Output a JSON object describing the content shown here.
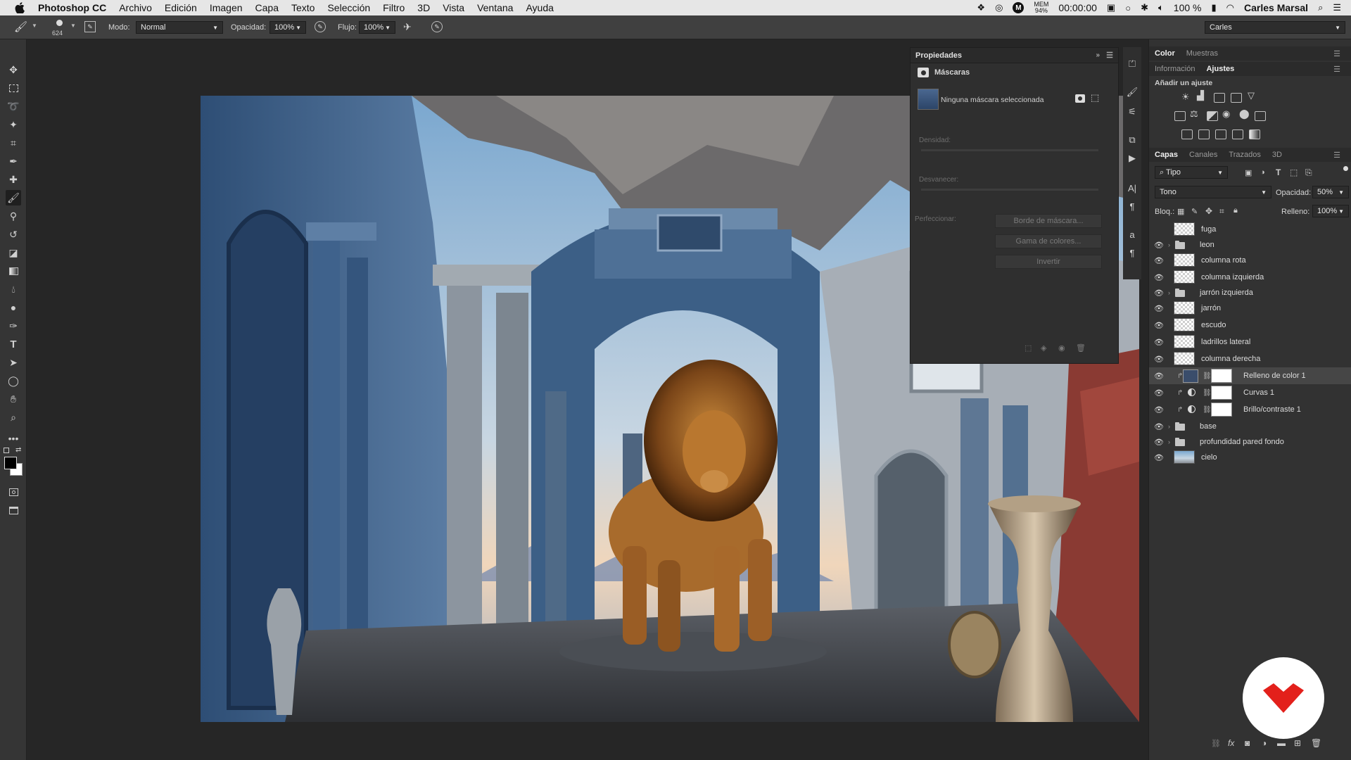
{
  "menubar": {
    "app": "Photoshop CC",
    "items": [
      "Archivo",
      "Edición",
      "Imagen",
      "Capa",
      "Texto",
      "Selección",
      "Filtro",
      "3D",
      "Vista",
      "Ventana",
      "Ayuda"
    ],
    "mem_label": "MEM",
    "mem_value": "94%",
    "timer": "00:00:00",
    "battery": "100 %",
    "user": "Carles Marsal"
  },
  "optionsbar": {
    "brush_size": "624",
    "modo_label": "Modo:",
    "modo_value": "Normal",
    "opacidad_label": "Opacidad:",
    "opacidad_value": "100%",
    "flujo_label": "Flujo:",
    "flujo_value": "100%",
    "workspace": "Carles"
  },
  "properties": {
    "title": "Propiedades",
    "section": "Máscaras",
    "mask_status": "Ninguna máscara seleccionada",
    "densidad_label": "Densidad:",
    "desvanecer_label": "Desvanecer:",
    "perfeccionar_label": "Perfeccionar:",
    "btn_borde": "Borde de máscara...",
    "btn_gama": "Gama de colores...",
    "btn_invertir": "Invertir"
  },
  "color_panel": {
    "tab1": "Color",
    "tab2": "Muestras"
  },
  "adjust_panel": {
    "tab1": "Información",
    "tab2": "Ajustes",
    "add_label": "Añadir un ajuste"
  },
  "layers_panel": {
    "tabs": [
      "Capas",
      "Canales",
      "Trazados",
      "3D"
    ],
    "filter_kind": "Tipo",
    "blend_mode": "Tono",
    "opacity_label": "Opacidad:",
    "opacity_value": "50%",
    "lock_label": "Bloq.:",
    "fill_label": "Relleno:",
    "fill_value": "100%",
    "layers": [
      {
        "name": "fuga",
        "type": "pixel",
        "visible": false
      },
      {
        "name": "leon",
        "type": "group",
        "visible": true
      },
      {
        "name": "columna rota",
        "type": "pixel",
        "visible": true
      },
      {
        "name": "columna izquierda",
        "type": "pixel",
        "visible": true
      },
      {
        "name": "jarrón izquierda",
        "type": "group",
        "visible": true
      },
      {
        "name": "jarrón",
        "type": "smart",
        "visible": true
      },
      {
        "name": "escudo",
        "type": "smart",
        "visible": true
      },
      {
        "name": "ladrillos lateral",
        "type": "pixel",
        "visible": true
      },
      {
        "name": "columna derecha",
        "type": "pixel",
        "visible": true
      },
      {
        "name": "Relleno de color 1",
        "type": "fill",
        "visible": true,
        "selected": true
      },
      {
        "name": "Curvas 1",
        "type": "adjustment",
        "visible": true
      },
      {
        "name": "Brillo/contraste 1",
        "type": "adjustment",
        "visible": true
      },
      {
        "name": "base",
        "type": "group",
        "visible": true
      },
      {
        "name": "profundidad pared fondo",
        "type": "group",
        "visible": true
      },
      {
        "name": "cielo",
        "type": "image",
        "visible": true
      }
    ]
  },
  "colors": {
    "fill_swatch": "#3a4d6b",
    "logo_red": "#e3201b"
  }
}
